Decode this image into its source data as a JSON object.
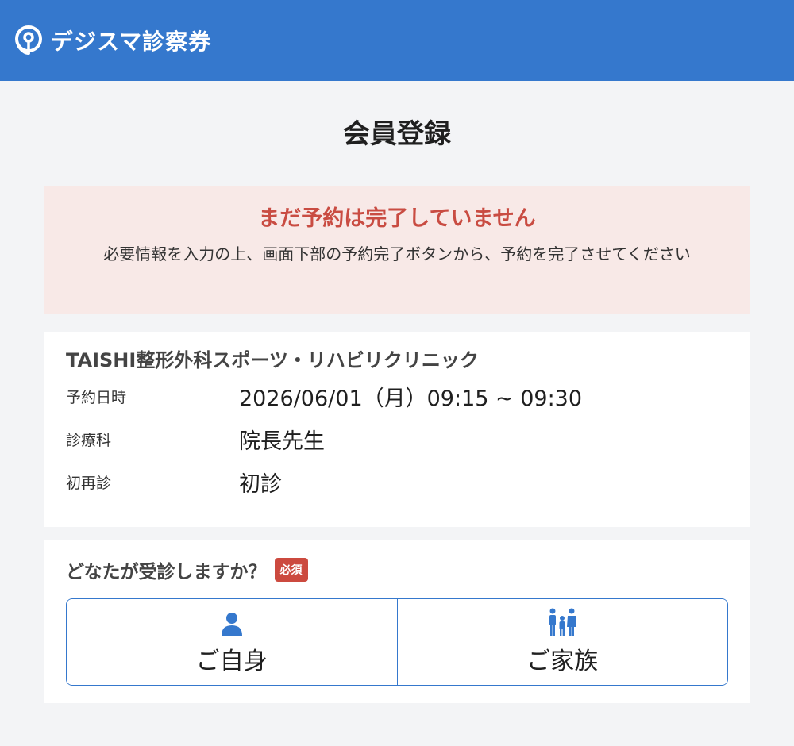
{
  "header": {
    "app_name": "デジスマ診察券",
    "logo_icon": "pin-logo-icon",
    "brand_color": "#3578cd"
  },
  "page": {
    "title": "会員登録"
  },
  "alert": {
    "title": "まだ予約は完了していません",
    "body": "必要情報を入力の上、画面下部の予約完了ボタンから、予約を完了させてください",
    "title_color": "#c94c42",
    "background_color": "#f8e9e7"
  },
  "reservation": {
    "clinic_name": "TAISHI整形外科スポーツ・リハビリクリニック",
    "rows": [
      {
        "label": "予約日時",
        "value": "2026/06/01（月）09:15 ~ 09:30"
      },
      {
        "label": "診療科",
        "value": "院長先生"
      },
      {
        "label": "初再診",
        "value": "初診"
      }
    ]
  },
  "patient_select": {
    "question": "どなたが受診しますか？",
    "required_badge": "必須",
    "options": [
      {
        "label": "ご自身",
        "icon": "person-icon"
      },
      {
        "label": "ご家族",
        "icon": "family-icon"
      }
    ]
  }
}
